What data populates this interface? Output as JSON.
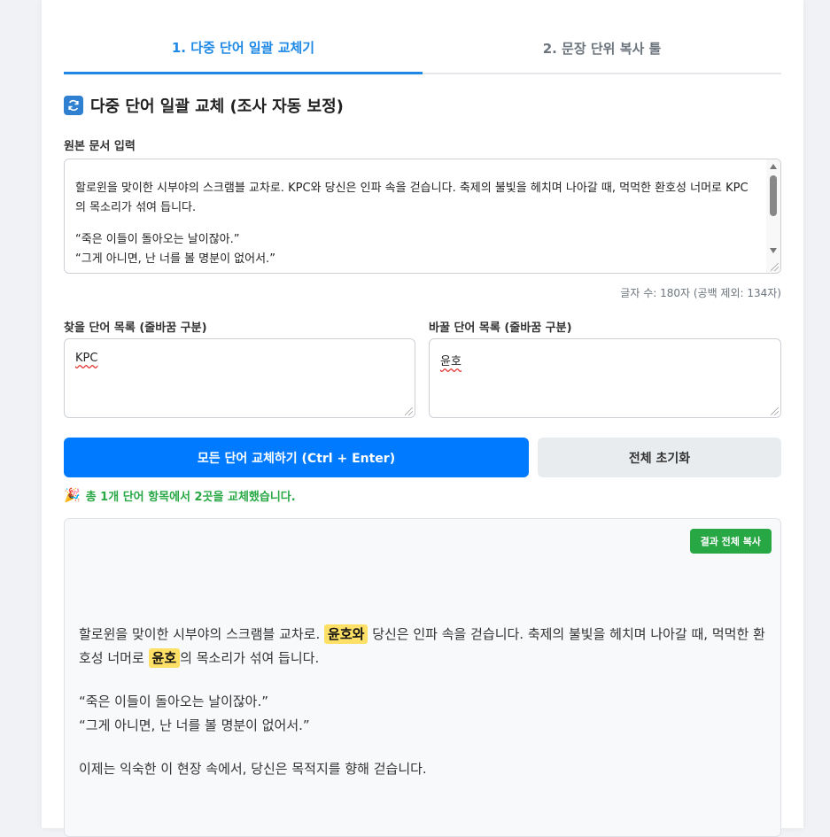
{
  "tabs": [
    {
      "label": "1. 다중 단어 일괄 교체기",
      "active": true
    },
    {
      "label": "2. 문장 단위 복사 툴",
      "active": false
    }
  ],
  "section": {
    "icon": "refresh-icon",
    "title": "다중 단어 일괄 교체 (조사 자동 보정)"
  },
  "source": {
    "label": "원본 문서 입력",
    "lines": [
      "할로윈을 맞이한 시부야의 스크램블 교차로. KPC와 당신은 인파 속을 걷습니다. 축제의 불빛을 헤치며 나아갈 때, 먹먹한 환호성 너머로 KPC의 목소리가 섞여 듭니다.",
      "",
      "“죽은 이들이 돌아오는 날이잖아.”",
      "“그게 아니면, 난 너를 볼 명분이 없어서.”"
    ],
    "count": "글자 수: 180자 (공백 제외: 134자)"
  },
  "find": {
    "label": "찾을 단어 목록 (줄바꿈 구분)",
    "value": "KPC"
  },
  "replace": {
    "label": "바꿀 단어 목록 (줄바꿈 구분)",
    "value": "윤호"
  },
  "buttons": {
    "replace_all": "모든 단어 교체하기 (Ctrl + Enter)",
    "reset": "전체 초기화",
    "copy_result": "결과 전체 복사"
  },
  "status": {
    "icon": "party-icon",
    "text": "총 1개 단어 항목에서 2곳을 교체했습니다."
  },
  "result": {
    "para1_pre": "할로윈을 맞이한 시부야의 스크램블 교차로. ",
    "para1_hl1": "윤호와",
    "para1_mid": " 당신은 인파 속을 걷습니다. 축제의 불빛을 헤치며 나아갈 때, 먹먹한 환호성 너머로 ",
    "para1_hl2": "윤호",
    "para1_post": "의 목소리가 섞여 듭니다.",
    "quote1": "“죽은 이들이 돌아오는 날이잖아.”",
    "quote2": "“그게 아니면, 난 너를 볼 명분이 없어서.”",
    "para3": "이제는 익숙한 이 현장 속에서, 당신은 목적지를 향해 걷습니다."
  }
}
